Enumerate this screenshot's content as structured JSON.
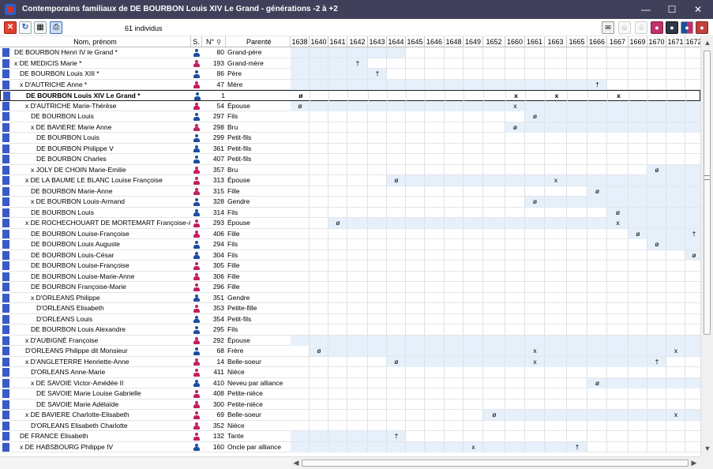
{
  "window": {
    "title": "Contemporains familiaux de DE BOURBON Louis XIV Le Grand  -  générations -2 à +2"
  },
  "toolbar": {
    "count_label": "61  individus"
  },
  "columns": {
    "name": "Nom, prénom",
    "sex": "S.",
    "num": "N°",
    "relation": "Parenté"
  },
  "years": [
    "1638",
    "1640",
    "1641",
    "1642",
    "1643",
    "1644",
    "1645",
    "1646",
    "1648",
    "1649",
    "1652",
    "1660",
    "1661",
    "1663",
    "1665",
    "1666",
    "1667",
    "1669",
    "1670",
    "1671",
    "1672"
  ],
  "rows": [
    {
      "name": "DE BOURBON Henri IV le Grand *",
      "indent": 0,
      "sex": "m",
      "num": "80",
      "rel": "Grand-père",
      "span": [
        0,
        6
      ],
      "events": []
    },
    {
      "name": "x DE MEDICIS Marie *",
      "indent": 0,
      "sex": "f",
      "num": "193",
      "rel": "Grand-mère",
      "span": [
        0,
        4
      ],
      "events": [
        [
          3,
          "†"
        ]
      ]
    },
    {
      "name": "DE BOURBON Louis XIII *",
      "indent": 1,
      "sex": "m",
      "num": "86",
      "rel": "Père",
      "span": [
        0,
        5
      ],
      "events": [
        [
          4,
          "†"
        ]
      ]
    },
    {
      "name": "x D'AUTRICHE Anne *",
      "indent": 1,
      "sex": "f",
      "num": "47",
      "rel": "Mère",
      "span": [
        0,
        16
      ],
      "events": [
        [
          15,
          "†"
        ]
      ]
    },
    {
      "name": "DE BOURBON Louis XIV Le Grand *",
      "indent": 2,
      "sex": "m",
      "num": "1",
      "rel": "",
      "span": null,
      "events": [
        [
          0,
          "ø"
        ],
        [
          11,
          "x"
        ],
        [
          13,
          "x"
        ],
        [
          16,
          "x"
        ]
      ],
      "current": true
    },
    {
      "name": "x D'AUTRICHE Marie-Thérèse",
      "indent": 2,
      "sex": "f",
      "num": "54",
      "rel": "Épouse",
      "span": [
        0,
        21
      ],
      "events": [
        [
          0,
          "ø"
        ],
        [
          11,
          "x"
        ]
      ]
    },
    {
      "name": "DE BOURBON Louis",
      "indent": 3,
      "sex": "m",
      "num": "297",
      "rel": "Fils",
      "span": [
        12,
        21
      ],
      "events": [
        [
          12,
          "ø"
        ]
      ]
    },
    {
      "name": "x DE BAVIERE Marie Anne",
      "indent": 3,
      "sex": "f",
      "num": "298",
      "rel": "Bru",
      "span": [
        11,
        21
      ],
      "events": [
        [
          11,
          "ø"
        ]
      ]
    },
    {
      "name": "DE BOURBON Louis",
      "indent": 4,
      "sex": "m",
      "num": "299",
      "rel": "Petit-fils",
      "span": null,
      "events": []
    },
    {
      "name": "DE BOURBON Philippe V",
      "indent": 4,
      "sex": "m",
      "num": "361",
      "rel": "Petit-fils",
      "span": null,
      "events": []
    },
    {
      "name": "DE BOURBON Charles",
      "indent": 4,
      "sex": "m",
      "num": "407",
      "rel": "Petit-fils",
      "span": null,
      "events": []
    },
    {
      "name": "x JOLY DE CHOIN Marie-Emilie",
      "indent": 3,
      "sex": "f",
      "num": "357",
      "rel": "Bru",
      "span": [
        18,
        21
      ],
      "events": [
        [
          18,
          "ø"
        ]
      ]
    },
    {
      "name": "x DE LA BAUME LE BLANC Louise Françoise",
      "indent": 2,
      "sex": "f",
      "num": "313",
      "rel": "Épouse",
      "span": [
        5,
        21
      ],
      "events": [
        [
          5,
          "ø"
        ],
        [
          13,
          "x"
        ]
      ]
    },
    {
      "name": "DE BOURBON Marie-Anne",
      "indent": 3,
      "sex": "f",
      "num": "315",
      "rel": "Fille",
      "span": [
        15,
        21
      ],
      "events": [
        [
          15,
          "ø"
        ]
      ]
    },
    {
      "name": "x DE BOURBON Louis-Armand",
      "indent": 3,
      "sex": "m",
      "num": "328",
      "rel": "Gendre",
      "span": [
        12,
        21
      ],
      "events": [
        [
          12,
          "ø"
        ]
      ]
    },
    {
      "name": "DE BOURBON Louis",
      "indent": 3,
      "sex": "m",
      "num": "314",
      "rel": "Fils",
      "span": [
        16,
        21
      ],
      "events": [
        [
          16,
          "ø"
        ]
      ]
    },
    {
      "name": "x DE ROCHECHOUART DE MORTEMART Françoise-Athénaïs",
      "indent": 2,
      "sex": "f",
      "num": "293",
      "rel": "Épouse",
      "span": [
        2,
        21
      ],
      "events": [
        [
          2,
          "ø"
        ],
        [
          16,
          "x"
        ]
      ]
    },
    {
      "name": "DE BOURBON Louise-Françoise",
      "indent": 3,
      "sex": "f",
      "num": "406",
      "rel": "Fille",
      "span": [
        17,
        21
      ],
      "events": [
        [
          17,
          "ø"
        ],
        [
          20,
          "†"
        ]
      ]
    },
    {
      "name": "DE BOURBON Louis Auguste",
      "indent": 3,
      "sex": "m",
      "num": "294",
      "rel": "Fils",
      "span": [
        18,
        21
      ],
      "events": [
        [
          18,
          "ø"
        ]
      ]
    },
    {
      "name": "DE BOURBON Louis-César",
      "indent": 3,
      "sex": "m",
      "num": "304",
      "rel": "Fils",
      "span": [
        20,
        21
      ],
      "events": [
        [
          20,
          "ø"
        ]
      ]
    },
    {
      "name": "DE BOURBON Louise-Françoise",
      "indent": 3,
      "sex": "f",
      "num": "305",
      "rel": "Fille",
      "span": null,
      "events": []
    },
    {
      "name": "DE BOURBON Louise-Marie-Anne",
      "indent": 3,
      "sex": "f",
      "num": "306",
      "rel": "Fille",
      "span": null,
      "events": []
    },
    {
      "name": "DE BOURBON Françoise-Marie",
      "indent": 3,
      "sex": "f",
      "num": "296",
      "rel": "Fille",
      "span": null,
      "events": []
    },
    {
      "name": "x D'ORLEANS Philippe",
      "indent": 3,
      "sex": "m",
      "num": "351",
      "rel": "Gendre",
      "span": null,
      "events": []
    },
    {
      "name": "D'ORLEANS Elisabeth",
      "indent": 4,
      "sex": "f",
      "num": "353",
      "rel": "Petite-fille",
      "span": null,
      "events": []
    },
    {
      "name": "D'ORLEANS Louis",
      "indent": 4,
      "sex": "m",
      "num": "354",
      "rel": "Petit-fils",
      "span": null,
      "events": []
    },
    {
      "name": "DE BOURBON Louis Alexandre",
      "indent": 3,
      "sex": "m",
      "num": "295",
      "rel": "Fils",
      "span": null,
      "events": []
    },
    {
      "name": "x D'AUBIGNÉ Françoise",
      "indent": 2,
      "sex": "f",
      "num": "292",
      "rel": "Épouse",
      "span": [
        0,
        21
      ],
      "events": []
    },
    {
      "name": "D'ORLEANS Philippe dit Monsieur",
      "indent": 2,
      "sex": "m",
      "num": "68",
      "rel": "Frère",
      "span": [
        1,
        21
      ],
      "events": [
        [
          1,
          "ø"
        ],
        [
          12,
          "x"
        ],
        [
          19,
          "x"
        ]
      ]
    },
    {
      "name": "x D'ANGLETERRE Henriette-Anne",
      "indent": 2,
      "sex": "f",
      "num": "14",
      "rel": "Belle-soeur",
      "span": [
        5,
        19
      ],
      "events": [
        [
          5,
          "ø"
        ],
        [
          12,
          "x"
        ],
        [
          18,
          "†"
        ]
      ]
    },
    {
      "name": "D'ORLEANS Anne-Marie",
      "indent": 3,
      "sex": "f",
      "num": "411",
      "rel": "Nièce",
      "span": null,
      "events": []
    },
    {
      "name": "x DE SAVOIE Victor-Amédée II",
      "indent": 3,
      "sex": "m",
      "num": "410",
      "rel": "Neveu par alliance",
      "span": [
        15,
        21
      ],
      "events": [
        [
          15,
          "ø"
        ]
      ]
    },
    {
      "name": "DE SAVOIE Marie Louise Gabrielle",
      "indent": 4,
      "sex": "f",
      "num": "408",
      "rel": "Petite-nièce",
      "span": null,
      "events": []
    },
    {
      "name": "DE SAVOIE Marie Adélaïde",
      "indent": 4,
      "sex": "f",
      "num": "300",
      "rel": "Petite-nièce",
      "span": null,
      "events": []
    },
    {
      "name": "x DE BAVIERE Charlotte-Elisabeth",
      "indent": 2,
      "sex": "f",
      "num": "69",
      "rel": "Belle-soeur",
      "span": [
        10,
        21
      ],
      "events": [
        [
          10,
          "ø"
        ],
        [
          19,
          "x"
        ]
      ]
    },
    {
      "name": "D'ORLEANS Elisabeth Charlotte",
      "indent": 3,
      "sex": "f",
      "num": "352",
      "rel": "Nièce",
      "span": null,
      "events": []
    },
    {
      "name": "DE FRANCE Elisabeth",
      "indent": 1,
      "sex": "f",
      "num": "132",
      "rel": "Tante",
      "span": [
        0,
        6
      ],
      "events": [
        [
          5,
          "†"
        ]
      ]
    },
    {
      "name": "x DE HABSBOURG Philippe IV",
      "indent": 1,
      "sex": "m",
      "num": "160",
      "rel": "Oncle par alliance",
      "span": [
        0,
        15
      ],
      "events": [
        [
          9,
          "x"
        ],
        [
          14,
          "†"
        ]
      ]
    }
  ]
}
